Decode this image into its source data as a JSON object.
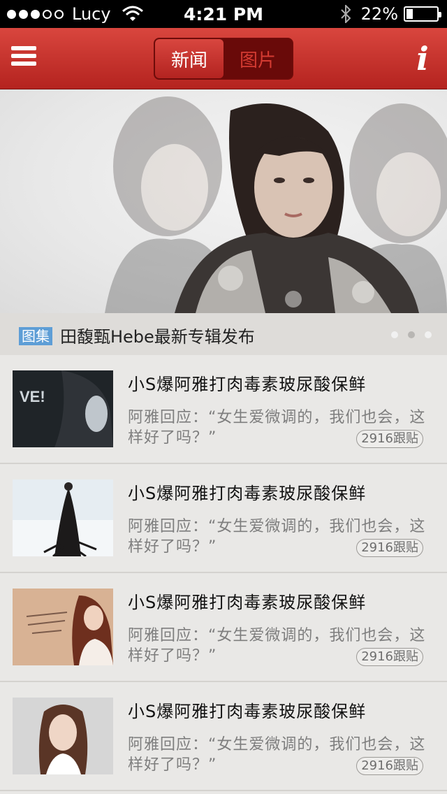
{
  "status_bar": {
    "carrier": "Lucy",
    "time": "4:21 PM",
    "battery": "22%",
    "battery_level": 0.22,
    "signal_bars_filled": 3,
    "signal_bars_total": 5
  },
  "nav": {
    "menu_icon": "hamburger-menu-icon",
    "tabs": [
      {
        "label": "新闻",
        "active": true
      },
      {
        "label": "图片",
        "active": false
      }
    ],
    "info_label": "i",
    "accent_color": "#c0312b"
  },
  "banner": {
    "tag": "图集",
    "caption": "田馥甄Hebe最新专辑发布",
    "pages": 3,
    "current_page": 2
  },
  "news": [
    {
      "title": "小S爆阿雅打肉毒素玻尿酸保鲜",
      "desc": "阿雅回应：“女生爱微调的，我们也会，这样好了吗？”",
      "count": "2916跟贴"
    },
    {
      "title": "小S爆阿雅打肉毒素玻尿酸保鲜",
      "desc": "阿雅回应：“女生爱微调的，我们也会，这样好了吗？”",
      "count": "2916跟贴"
    },
    {
      "title": "小S爆阿雅打肉毒素玻尿酸保鲜",
      "desc": "阿雅回应：“女生爱微调的，我们也会，这样好了吗？”",
      "count": "2916跟贴"
    },
    {
      "title": "小S爆阿雅打肉毒素玻尿酸保鲜",
      "desc": "阿雅回应：“女生爱微调的，我们也会，这样好了吗？”",
      "count": "2916跟贴"
    }
  ]
}
